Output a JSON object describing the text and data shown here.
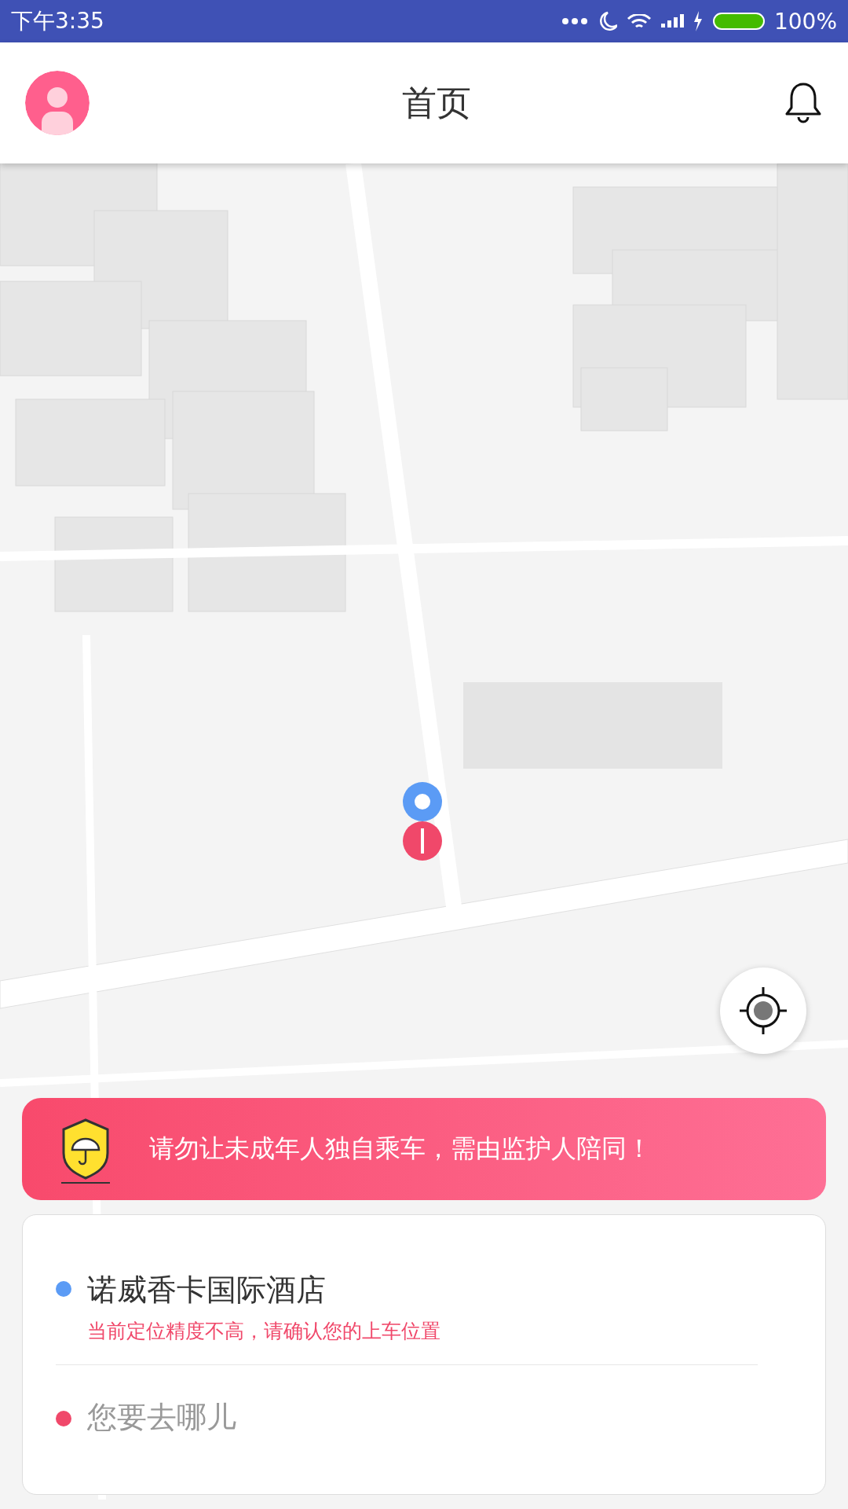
{
  "status_bar": {
    "time": "下午3:35",
    "battery": "100%"
  },
  "header": {
    "title": "首页"
  },
  "notice": {
    "text": "请勿让未成年人独自乘车，需由监护人陪同！"
  },
  "locations": [
    {
      "kind": "place",
      "color": "#5b9bf5",
      "name": "诺威香卡国际酒店",
      "warning": "当前定位精度不高，请确认您的上车位置"
    },
    {
      "kind": "input",
      "color": "#f0486a",
      "placeholder": "您要去哪儿"
    }
  ]
}
